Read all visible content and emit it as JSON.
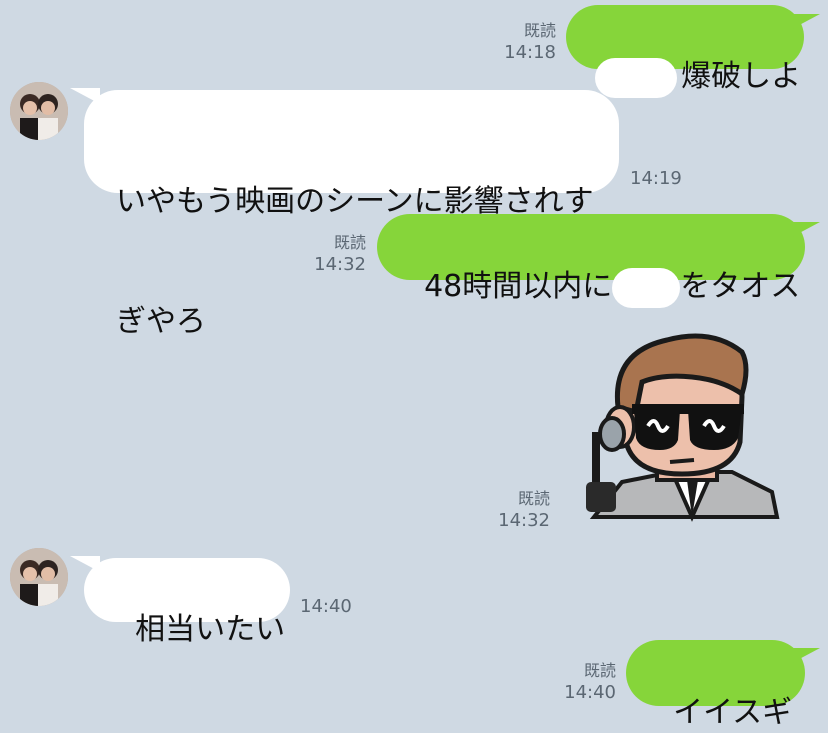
{
  "colors": {
    "background": "#cfd9e3",
    "outgoing_bubble": "#86d53a",
    "incoming_bubble": "#ffffff",
    "meta_text": "#5b6773"
  },
  "messages": [
    {
      "id": 1,
      "direction": "outgoing",
      "text_after_redaction": "爆破しよ",
      "read": "既読",
      "time": "14:18"
    },
    {
      "id": 2,
      "direction": "incoming",
      "text_line1": "いやもう映画のシーンに影響されす",
      "text_line2": "ぎやろ",
      "time": "14:19"
    },
    {
      "id": 3,
      "direction": "outgoing",
      "text_before_redaction": "48時間以内に",
      "text_after_redaction": "をタオス",
      "read": "既読",
      "time": "14:32"
    },
    {
      "id": 4,
      "direction": "outgoing",
      "type": "sticker",
      "sticker_icon": "sunglasses-agent-sticker",
      "read": "既読",
      "time": "14:32"
    },
    {
      "id": 5,
      "direction": "incoming",
      "text": "相当いたい",
      "time": "14:40"
    },
    {
      "id": 6,
      "direction": "outgoing",
      "text": "イイスギ",
      "read": "既読",
      "time": "14:40"
    }
  ]
}
